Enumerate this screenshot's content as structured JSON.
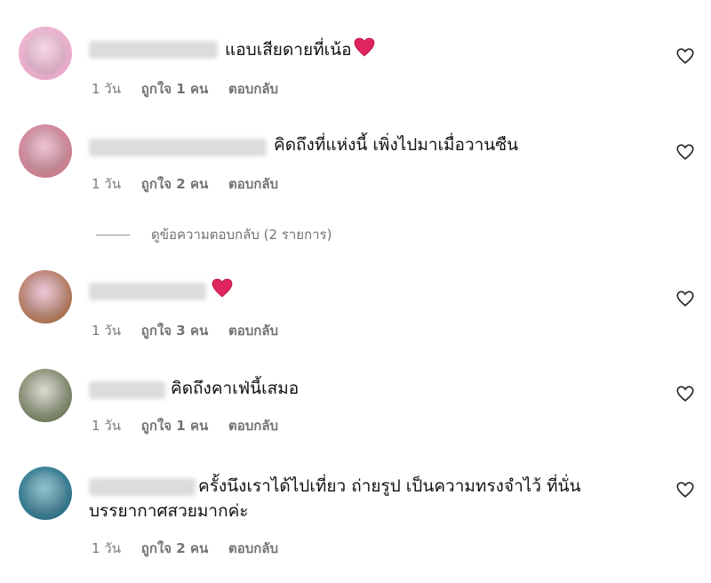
{
  "colors": {
    "meta_text": "#737373",
    "heart_emoji": "#e0245e"
  },
  "meta_labels": {
    "age": "1 วัน",
    "reply": "ตอบกลับ"
  },
  "comments": [
    {
      "username": "pearfoxe",
      "text": "แอบเสียดายที่เน้อ",
      "heart_emoji": "heart-emoji",
      "likes": "ถูกใจ 1 คน",
      "avatar_colors": [
        "#f2c6dd",
        "#e8a9c8"
      ]
    },
    {
      "username": "yoozi_bellepuy",
      "text": "คิดถึงที่แห่งนี้ เพิ่งไปมาเมื่อวานซืน",
      "likes": "ถูกใจ 2 คน",
      "avatar_colors": [
        "#e6a6c0",
        "#c67d8a"
      ]
    },
    {
      "username": "daisy_photo",
      "text": "",
      "heart_emoji": "heart-emoji",
      "likes": "ถูกใจ 3 คน",
      "avatar_colors": [
        "#e8b0c8",
        "#a7704c"
      ]
    },
    {
      "username": "bapang",
      "text": "คิดถึงคาเฟ่นี้เสมอ",
      "likes": "ถูกใจ 1 คน",
      "avatar_colors": [
        "#c9cbb8",
        "#6f7a5c"
      ]
    },
    {
      "username": "flowers_bar",
      "text": "ครั้งนึงเราได้ไปเที่ยว ถ่ายรูป เป็นความทรงจำไว้ ที่นั่นบรรยากาศสวยมากค่ะ",
      "likes": "ถูกใจ 2 คน",
      "avatar_colors": [
        "#5aa6b8",
        "#2f6f85"
      ]
    }
  ],
  "view_replies": "ดูข้อความตอบกลับ (2 รายการ)"
}
